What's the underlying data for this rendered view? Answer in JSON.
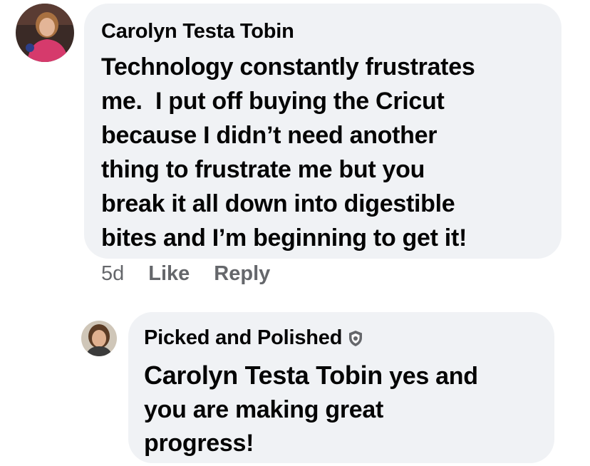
{
  "comment": {
    "author": "Carolyn Testa Tobin",
    "text": "Technology constantly frustrates me.  I put off buying the Cricut because I didn’t need another thing to frustrate me but you break it all down into digestible bites and I’m beginning to get it!",
    "lines": [
      "Technology constantly frustrates",
      "me.  I put off buying the Cricut",
      "because I didn’t need another",
      "thing to frustrate me but you",
      "break it all down into digestible",
      "bites and I’m beginning to get it!"
    ],
    "timestamp": "5d",
    "like_label": "Like",
    "reply_label": "Reply"
  },
  "reply": {
    "author": "Picked and Polished",
    "badge_icon": "shield-icon",
    "mention": "Carolyn Testa Tobin",
    "line1_rest": " yes and",
    "line2": "you are making great",
    "line3": "progress!"
  },
  "colors": {
    "bubble_bg": "#f0f2f5",
    "text": "#050505",
    "secondary": "#65676b"
  }
}
